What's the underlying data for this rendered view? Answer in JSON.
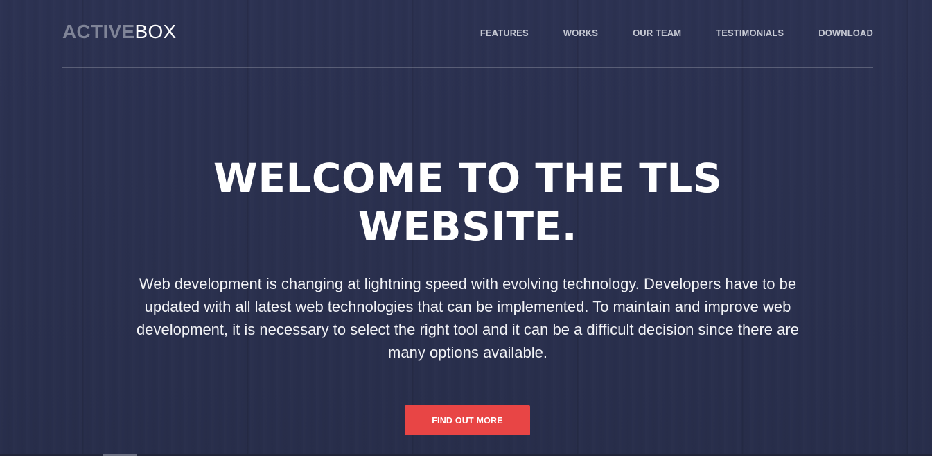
{
  "brand": {
    "logo_bold": "ACTIVE",
    "logo_light": "BOX"
  },
  "nav": {
    "items": [
      {
        "label": "FEATURES"
      },
      {
        "label": "WORKS"
      },
      {
        "label": "OUR TEAM"
      },
      {
        "label": "TESTIMONIALS"
      },
      {
        "label": "DOWNLOAD"
      }
    ]
  },
  "hero": {
    "title_line1": "WELCOME TO THE TLS",
    "title_line2": "WEBSITE.",
    "text": "Web development is changing at lightning speed with evolving technology. Developers have to be updated with all latest web technologies that can be implemented. To maintain and improve web development, it is necessary to select the right tool and it can be a difficult decision since there are many options available.",
    "cta_label": "FIND OUT MORE"
  },
  "colors": {
    "background": "#2b3150",
    "accent": "#e84545",
    "logo_muted": "#7f8497",
    "nav_text": "#c7cad4"
  }
}
